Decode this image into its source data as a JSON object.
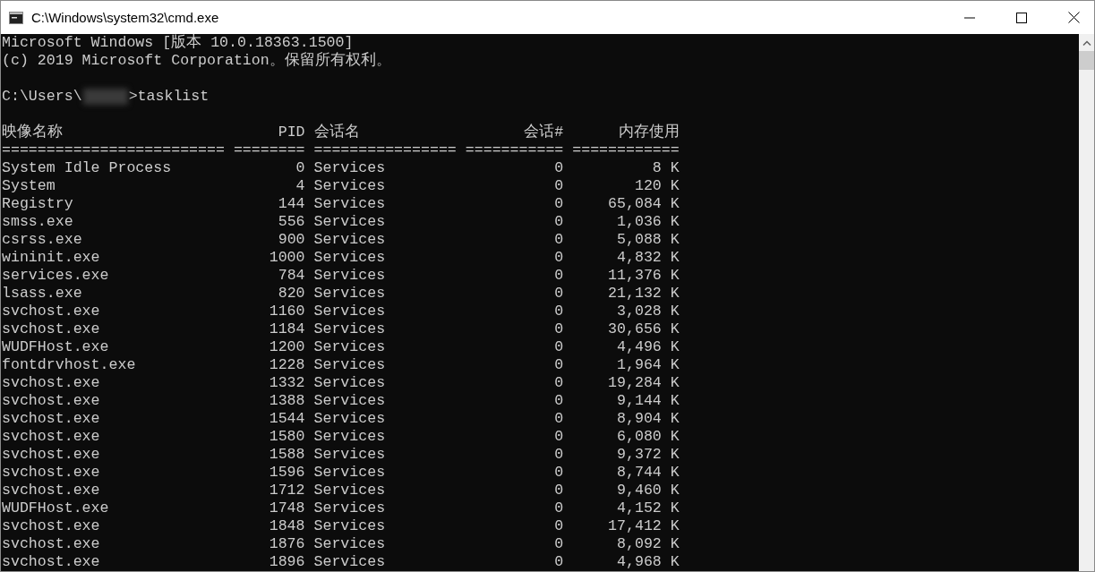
{
  "window": {
    "title": "C:\\Windows\\system32\\cmd.exe"
  },
  "console": {
    "banner": [
      "Microsoft Windows [版本 10.0.18363.1500]",
      "(c) 2019 Microsoft Corporation。保留所有权利。"
    ],
    "prompt": {
      "before": "C:\\Users\\",
      "after": ">tasklist"
    },
    "columns": [
      {
        "label": "映像名称",
        "rule": "========================="
      },
      {
        "label": "PID",
        "rule": "========"
      },
      {
        "label": "会话名",
        "rule": "================"
      },
      {
        "label": "会话#",
        "rule": "==========="
      },
      {
        "label": "内存使用",
        "rule": "============"
      }
    ],
    "rows": [
      [
        "System Idle Process",
        "0",
        "Services",
        "0",
        "8 K"
      ],
      [
        "System",
        "4",
        "Services",
        "0",
        "120 K"
      ],
      [
        "Registry",
        "144",
        "Services",
        "0",
        "65,084 K"
      ],
      [
        "smss.exe",
        "556",
        "Services",
        "0",
        "1,036 K"
      ],
      [
        "csrss.exe",
        "900",
        "Services",
        "0",
        "5,088 K"
      ],
      [
        "wininit.exe",
        "1000",
        "Services",
        "0",
        "4,832 K"
      ],
      [
        "services.exe",
        "784",
        "Services",
        "0",
        "11,376 K"
      ],
      [
        "lsass.exe",
        "820",
        "Services",
        "0",
        "21,132 K"
      ],
      [
        "svchost.exe",
        "1160",
        "Services",
        "0",
        "3,028 K"
      ],
      [
        "svchost.exe",
        "1184",
        "Services",
        "0",
        "30,656 K"
      ],
      [
        "WUDFHost.exe",
        "1200",
        "Services",
        "0",
        "4,496 K"
      ],
      [
        "fontdrvhost.exe",
        "1228",
        "Services",
        "0",
        "1,964 K"
      ],
      [
        "svchost.exe",
        "1332",
        "Services",
        "0",
        "19,284 K"
      ],
      [
        "svchost.exe",
        "1388",
        "Services",
        "0",
        "9,144 K"
      ],
      [
        "svchost.exe",
        "1544",
        "Services",
        "0",
        "8,904 K"
      ],
      [
        "svchost.exe",
        "1580",
        "Services",
        "0",
        "6,080 K"
      ],
      [
        "svchost.exe",
        "1588",
        "Services",
        "0",
        "9,372 K"
      ],
      [
        "svchost.exe",
        "1596",
        "Services",
        "0",
        "8,744 K"
      ],
      [
        "svchost.exe",
        "1712",
        "Services",
        "0",
        "9,460 K"
      ],
      [
        "WUDFHost.exe",
        "1748",
        "Services",
        "0",
        "4,152 K"
      ],
      [
        "svchost.exe",
        "1848",
        "Services",
        "0",
        "17,412 K"
      ],
      [
        "svchost.exe",
        "1876",
        "Services",
        "0",
        "8,092 K"
      ],
      [
        "svchost.exe",
        "1896",
        "Services",
        "0",
        "4,968 K"
      ]
    ]
  }
}
